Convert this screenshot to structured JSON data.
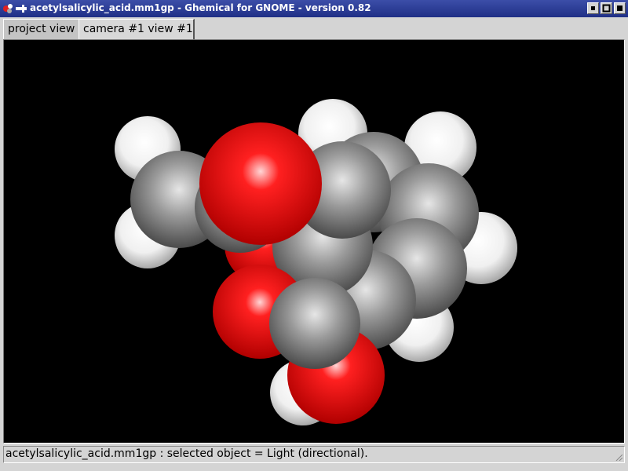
{
  "window": {
    "title": "acetylsalicylic_acid.mm1gp - Ghemical for GNOME - version 0.82",
    "controls": [
      "minimize-icon",
      "maximize-icon",
      "close-icon"
    ]
  },
  "tabs": [
    {
      "label": "project view",
      "active": false
    },
    {
      "label": "camera #1 view #1",
      "active": true
    }
  ],
  "viewport": {
    "description_icon": "molecule-render",
    "background": "#000000",
    "atom_colors": {
      "carbon": "#808080",
      "oxygen": "#ff0000",
      "hydrogen": "#ffffff"
    }
  },
  "status": {
    "text": "acetylsalicylic_acid.mm1gp : selected object = Light (directional)."
  }
}
